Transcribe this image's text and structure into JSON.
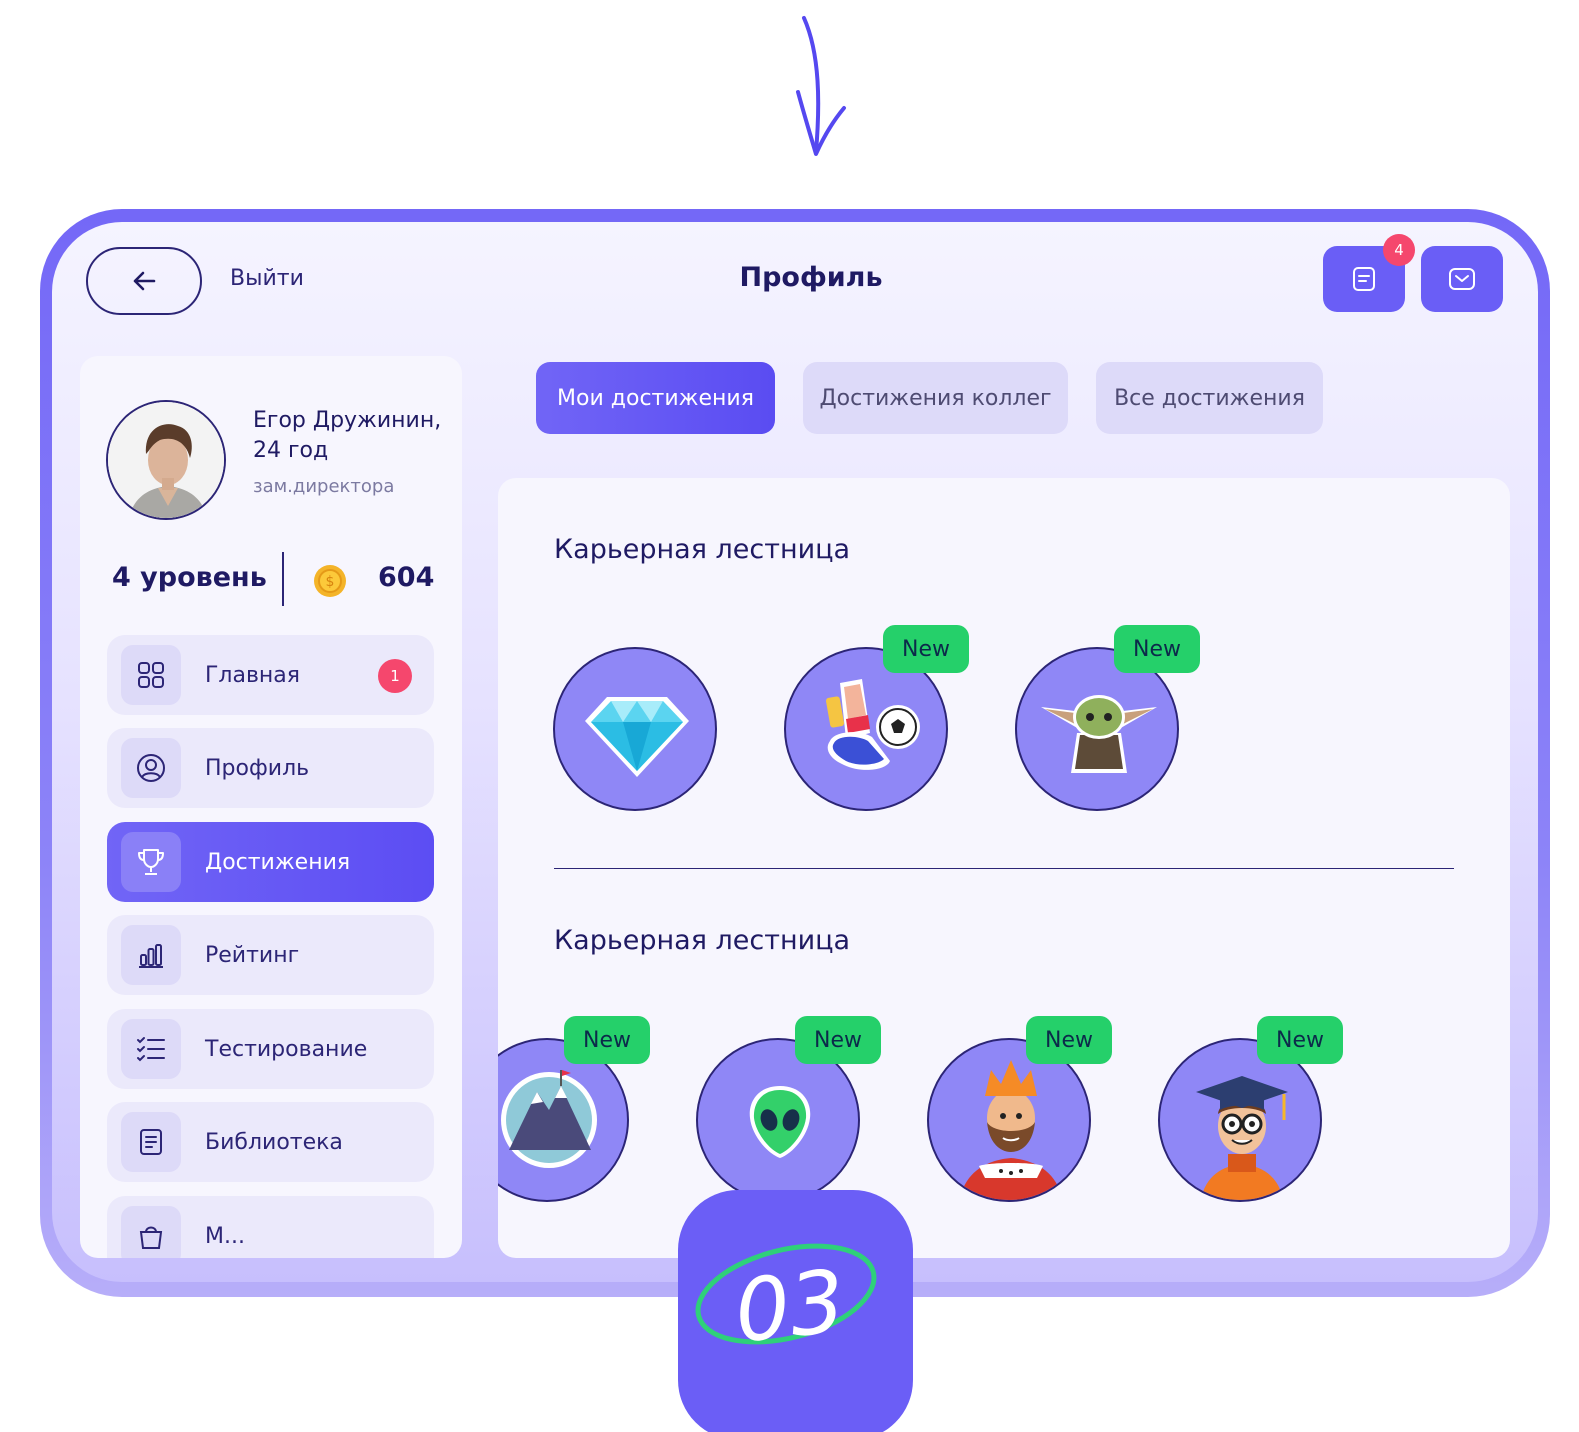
{
  "header": {
    "title": "Профиль",
    "exit_label": "Выйти",
    "notifications_count": "4"
  },
  "user": {
    "name": "Егор Дружинин, 24 год",
    "role": "зам.директора",
    "level": "4 уровень",
    "coins": "604"
  },
  "menu": [
    {
      "label": "Главная",
      "icon": "grid-icon",
      "badge": "1"
    },
    {
      "label": "Профиль",
      "icon": "user-icon"
    },
    {
      "label": "Достижения",
      "icon": "trophy-icon",
      "active": true
    },
    {
      "label": "Рейтинг",
      "icon": "bar-chart-icon"
    },
    {
      "label": "Тестирование",
      "icon": "checklist-icon"
    },
    {
      "label": "Библиотека",
      "icon": "book-icon"
    },
    {
      "label": "М...",
      "icon": "bag-icon"
    }
  ],
  "tabs": [
    {
      "label": "Мои достижения",
      "active": true
    },
    {
      "label": "Достижения коллег"
    },
    {
      "label": "Все достижения"
    }
  ],
  "sections": [
    {
      "title": "Карьерная лестница",
      "achievements": [
        {
          "icon": "diamond-icon",
          "badge": ""
        },
        {
          "icon": "football-boot-icon",
          "badge": "New"
        },
        {
          "icon": "baby-yoda-icon",
          "badge": "New"
        }
      ]
    },
    {
      "title": "Карьерная лестница",
      "achievements": [
        {
          "icon": "mountain-icon",
          "badge": "New"
        },
        {
          "icon": "alien-icon",
          "badge": "New"
        },
        {
          "icon": "king-icon",
          "badge": "New"
        },
        {
          "icon": "graduate-icon",
          "badge": "New"
        }
      ]
    }
  ],
  "step_label": "03",
  "colors": {
    "accent": "#6a5ef6",
    "badge_new": "#25d06a",
    "badge_alert": "#f5476d",
    "text_dark": "#1f1a63"
  }
}
